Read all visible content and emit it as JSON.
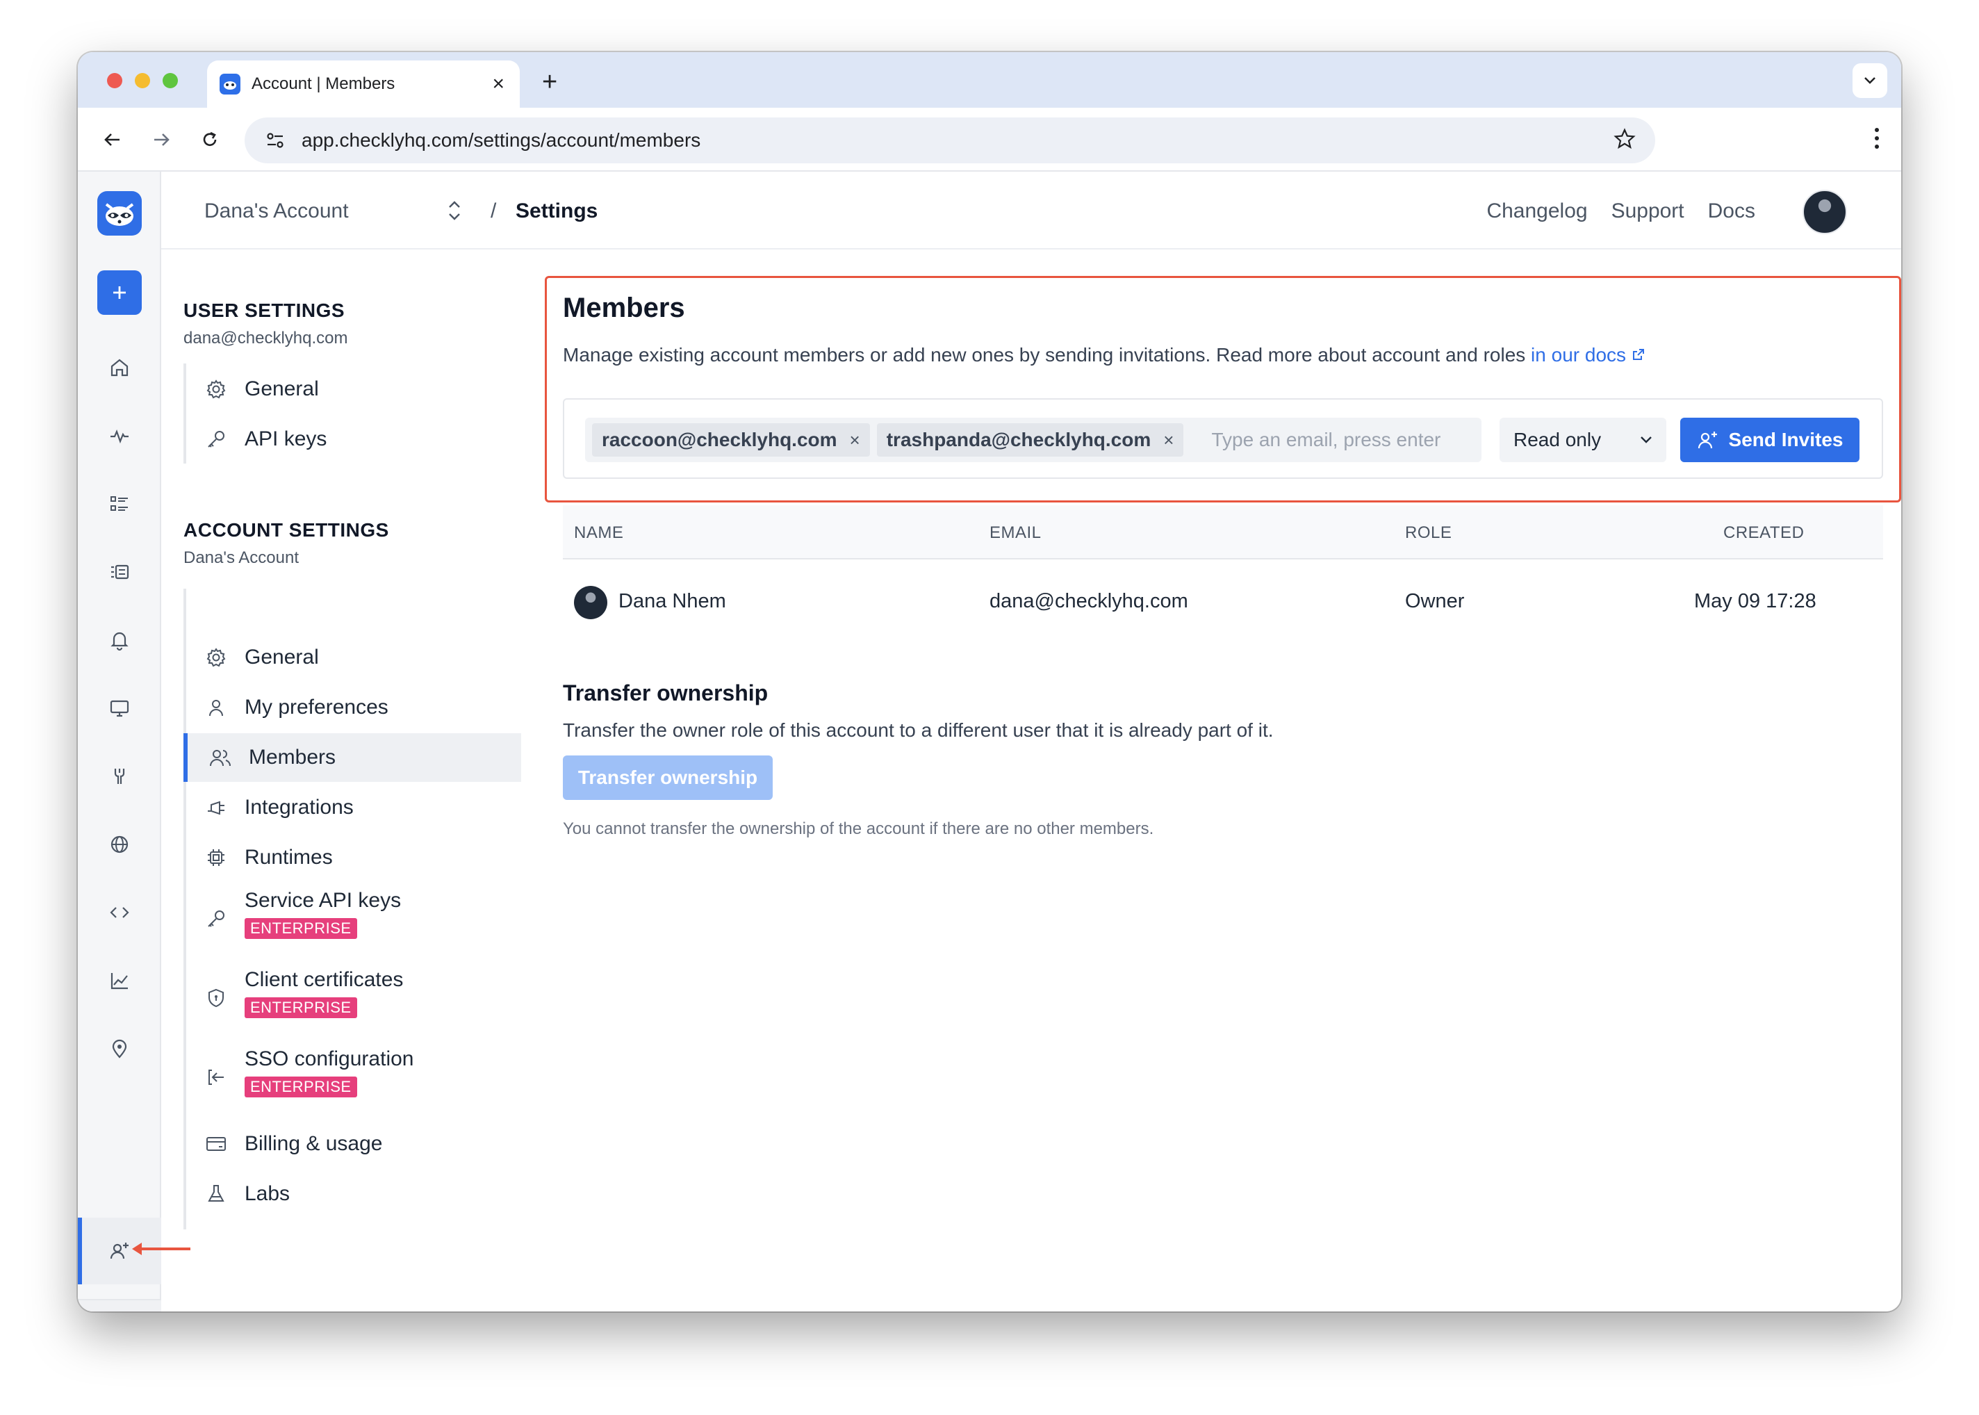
{
  "browser": {
    "tab_title": "Account | Members",
    "url_host": "app.checklyhq.com",
    "url_path": "/settings/account/members"
  },
  "topbar": {
    "account_name": "Dana's Account",
    "separator": "/",
    "page": "Settings",
    "links": [
      "Changelog",
      "Support",
      "Docs"
    ]
  },
  "settings_nav": {
    "user_section": {
      "title": "USER SETTINGS",
      "subtitle": "dana@checklyhq.com",
      "items": [
        {
          "label": "General",
          "icon": "gear-icon"
        },
        {
          "label": "API keys",
          "icon": "key-icon"
        }
      ]
    },
    "account_section": {
      "title": "ACCOUNT SETTINGS",
      "subtitle": "Dana's Account",
      "items": [
        {
          "label": "General",
          "icon": "gear-icon"
        },
        {
          "label": "My preferences",
          "icon": "user-icon"
        },
        {
          "label": "Members",
          "icon": "users-icon",
          "active": true
        },
        {
          "label": "Integrations",
          "icon": "plug-icon"
        },
        {
          "label": "Runtimes",
          "icon": "chip-icon"
        },
        {
          "label": "Service API keys",
          "icon": "key-icon",
          "badge": "ENTERPRISE"
        },
        {
          "label": "Client certificates",
          "icon": "shield-icon",
          "badge": "ENTERPRISE"
        },
        {
          "label": "SSO configuration",
          "icon": "sign-in-icon",
          "badge": "ENTERPRISE"
        },
        {
          "label": "Billing & usage",
          "icon": "credit-card-icon"
        },
        {
          "label": "Labs",
          "icon": "flask-icon"
        }
      ]
    }
  },
  "members": {
    "title": "Members",
    "description": "Manage existing account members or add new ones by sending invitations. Read more about account and roles ",
    "docs_link": "in our docs",
    "invite": {
      "chips": [
        "raccoon@checklyhq.com",
        "trashpanda@checklyhq.com"
      ],
      "chip_remove": "×",
      "placeholder": "Type an email, press enter",
      "role_value": "Read only",
      "send_label": "Send Invites"
    },
    "table": {
      "columns": [
        "NAME",
        "EMAIL",
        "ROLE",
        "CREATED"
      ],
      "rows": [
        {
          "name": "Dana Nhem",
          "email": "dana@checklyhq.com",
          "role": "Owner",
          "created": "May 09 17:28"
        }
      ]
    }
  },
  "transfer": {
    "title": "Transfer ownership",
    "description": "Transfer the owner role of this account to a different user that it is already part of it.",
    "button": "Transfer ownership",
    "note": "You cannot transfer the ownership of the account if there are no other members."
  },
  "colors": {
    "accent": "#2f6ee6",
    "highlight_border": "#e8553f",
    "enterprise_badge": "#e63f7c",
    "disabled_button": "#9ec0f7"
  }
}
